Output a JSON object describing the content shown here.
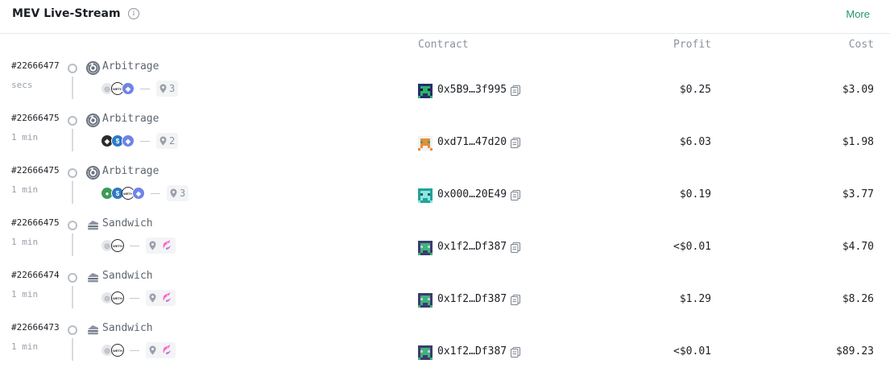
{
  "header": {
    "title": "MEV Live-Stream",
    "more_label": "More",
    "info_icon": "info-icon"
  },
  "columns": {
    "contract": "Contract",
    "profit": "Profit",
    "cost": "Cost"
  },
  "colors": {
    "accent": "#21976a",
    "muted": "#8c939c"
  },
  "rows": [
    {
      "block": "#22666477",
      "time": "secs",
      "type": "Arbitrage",
      "type_icon": "arbitrage-icon",
      "tokens": [
        "grey",
        "weth",
        "eth"
      ],
      "hops": "3",
      "contract": "0x5B9…3f995",
      "avatar": "dark-blue-green",
      "profit": "$0.25",
      "cost": "$3.09"
    },
    {
      "block": "#22666475",
      "time": "1 min",
      "type": "Arbitrage",
      "type_icon": "arbitrage-icon",
      "tokens": [
        "black",
        "usdc",
        "eth"
      ],
      "hops": "2",
      "contract": "0xd71…47d20",
      "avatar": "orange-green",
      "profit": "$6.03",
      "cost": "$1.98"
    },
    {
      "block": "#22666475",
      "time": "1 min",
      "type": "Arbitrage",
      "type_icon": "arbitrage-icon",
      "tokens": [
        "green",
        "usdc",
        "weth",
        "eth"
      ],
      "hops": "3",
      "contract": "0x000…20E49",
      "avatar": "teal",
      "profit": "$0.19",
      "cost": "$3.77"
    },
    {
      "block": "#22666475",
      "time": "1 min",
      "type": "Sandwich",
      "type_icon": "sandwich-icon",
      "tokens": [
        "grey",
        "weth"
      ],
      "hops": "",
      "contract": "0x1f2…Df387",
      "avatar": "purple-green",
      "profit": "<$0.01",
      "cost": "$4.70"
    },
    {
      "block": "#22666474",
      "time": "1 min",
      "type": "Sandwich",
      "type_icon": "sandwich-icon",
      "tokens": [
        "grey",
        "weth"
      ],
      "hops": "",
      "contract": "0x1f2…Df387",
      "avatar": "purple-green",
      "profit": "$1.29",
      "cost": "$8.26"
    },
    {
      "block": "#22666473",
      "time": "1 min",
      "type": "Sandwich",
      "type_icon": "sandwich-icon",
      "tokens": [
        "grey",
        "weth"
      ],
      "hops": "",
      "contract": "0x1f2…Df387",
      "avatar": "purple-green",
      "profit": "<$0.01",
      "cost": "$89.23"
    }
  ]
}
